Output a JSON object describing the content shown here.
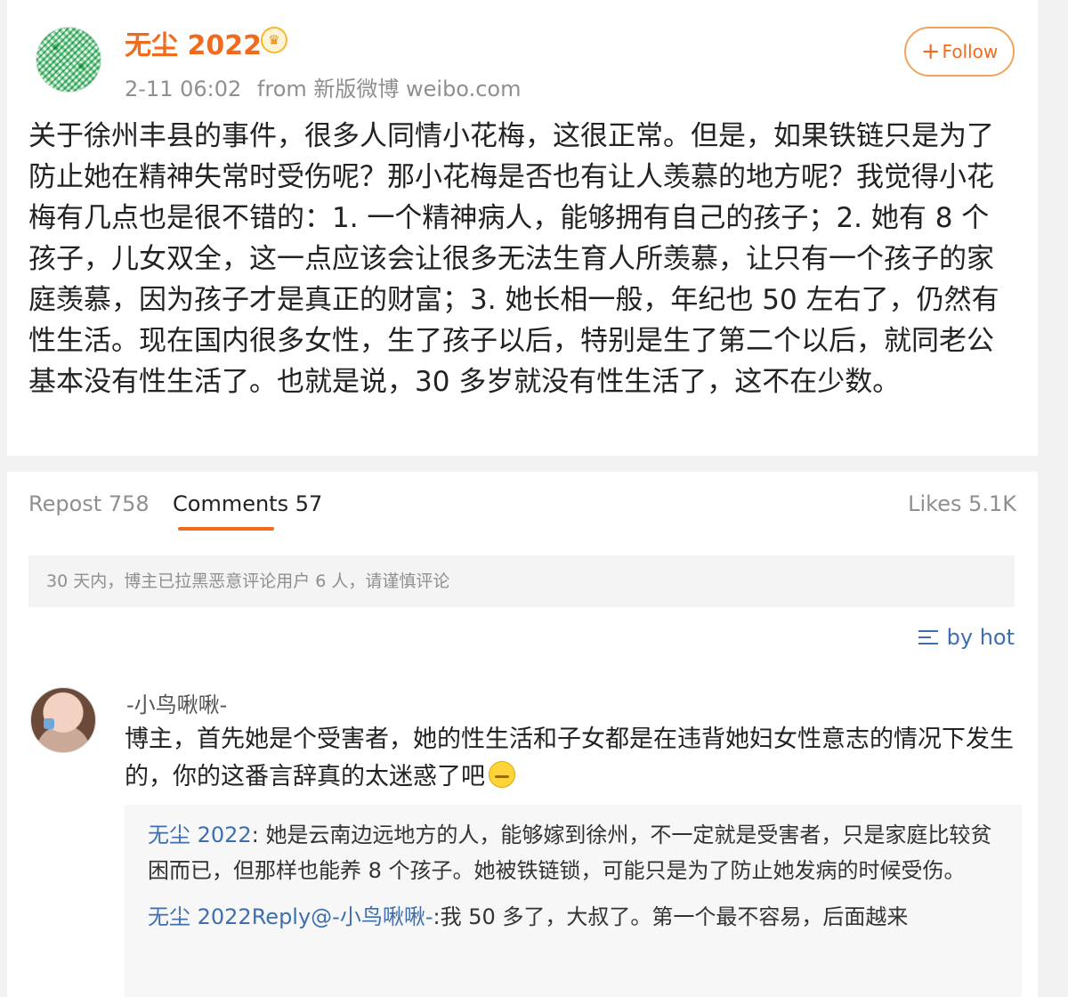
{
  "post": {
    "author": "无尘 2022",
    "verified_icon": "crown-icon",
    "time": "2-11 06:02",
    "source": "from 新版微博 weibo.com",
    "follow_label": "Follow",
    "follow_icon": "+",
    "text": "关于徐州丰县的事件，很多人同情小花梅，这很正常。但是，如果铁链只是为了防止她在精神失常时受伤呢？那小花梅是否也有让人羡慕的地方呢？我觉得小花梅有几点也是很不错的：1. 一个精神病人，能够拥有自己的孩子；2. 她有 8 个孩子，儿女双全，这一点应该会让很多无法生育人所羡慕，让只有一个孩子的家庭羡慕，因为孩子才是真正的财富；3. 她长相一般，年纪也 50 左右了，仍然有性生活。现在国内很多女性，生了孩子以后，特别是生了第二个以后，就同老公基本没有性生活了。也就是说，30 多岁就没有性生活了，这不在少数。"
  },
  "tabs": {
    "repost": "Repost 758",
    "comments": "Comments 57",
    "likes": "Likes 5.1K"
  },
  "notice": "30 天内，博主已拉黑恶意评论用户 6 人，请谨慎评论",
  "sort_label": "by hot",
  "comment": {
    "author": "-小鸟啾啾-",
    "text": "博主，首先她是个受害者，她的性生活和子女都是在违背她妇女性意志的情况下发生的，你的这番言辞真的太迷惑了吧",
    "emoji": "squint-face-icon",
    "replies": [
      {
        "author": "无尘 2022",
        "sep": ": ",
        "text": "她是云南边远地方的人，能够嫁到徐州，不一定就是受害者，只是家庭比较贫困而已，但那样也能养 8 个孩子。她被铁链锁，可能只是为了防止她发病的时候受伤。"
      },
      {
        "author": "无尘 2022Reply@-小鸟啾啾-",
        "sep": ":",
        "text": "我 50 多了，大叔了。第一个最不容易，后面越来"
      }
    ]
  }
}
